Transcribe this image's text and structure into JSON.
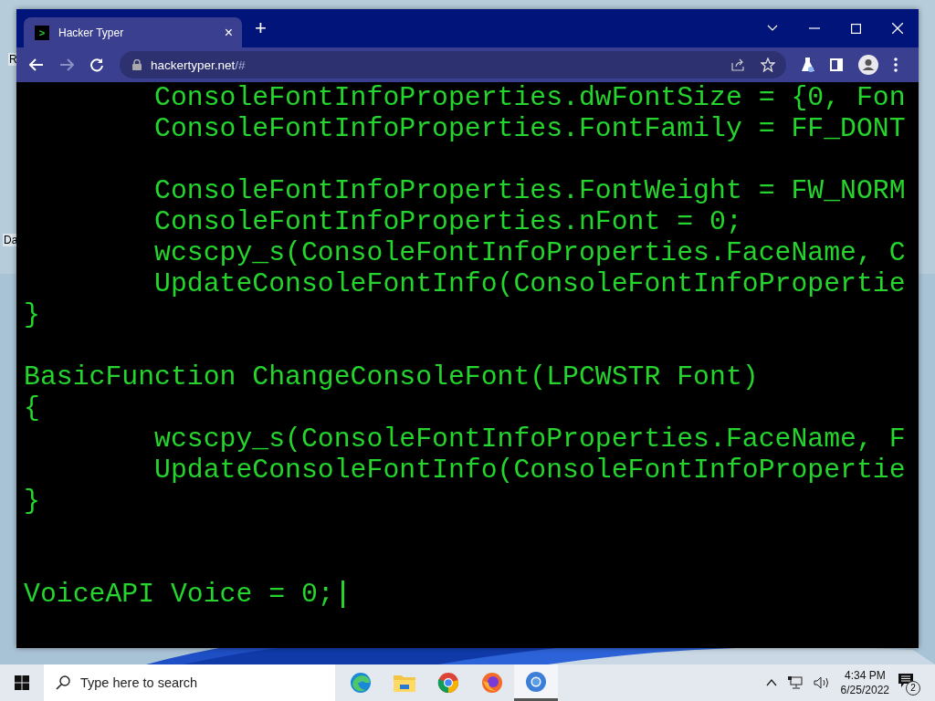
{
  "desktop": {
    "icon_labels": [
      "R",
      "Da"
    ]
  },
  "window": {
    "tabs": [
      {
        "title": "Hacker Typer",
        "selected": true,
        "favicon": ">",
        "close": "×"
      }
    ],
    "new_tab": "+",
    "address": {
      "host": "hackertyper.net",
      "path": "/#"
    }
  },
  "code": {
    "cursor_visible": true,
    "lines": [
      {
        "kind": "code",
        "text": "        ConsoleFontInfoProperties.dwFontSize = {0, Fon"
      },
      {
        "kind": "code",
        "text": "        ConsoleFontInfoProperties.FontFamily = FF_DONT"
      },
      {
        "kind": "blank"
      },
      {
        "kind": "code",
        "text": "        ConsoleFontInfoProperties.FontWeight = FW_NORM"
      },
      {
        "kind": "code",
        "text": "        ConsoleFontInfoProperties.nFont = 0;"
      },
      {
        "kind": "code",
        "text": "        wcscpy_s(ConsoleFontInfoProperties.FaceName, C"
      },
      {
        "kind": "code",
        "text": "        UpdateConsoleFontInfo(ConsoleFontInfoPropertie"
      },
      {
        "kind": "code",
        "text": "}"
      },
      {
        "kind": "blank"
      },
      {
        "kind": "code",
        "text": "BasicFunction ChangeConsoleFont(LPCWSTR Font)"
      },
      {
        "kind": "code",
        "text": "{"
      },
      {
        "kind": "code",
        "text": "        wcscpy_s(ConsoleFontInfoProperties.FaceName, F"
      },
      {
        "kind": "code",
        "text": "        UpdateConsoleFontInfo(ConsoleFontInfoPropertie"
      },
      {
        "kind": "code",
        "text": "}"
      },
      {
        "kind": "blank"
      },
      {
        "kind": "blank"
      },
      {
        "kind": "code",
        "text": "VoiceAPI Voice = 0;"
      }
    ]
  },
  "taskbar": {
    "search": {
      "placeholder": "Type here to search"
    },
    "apps": [
      {
        "kind": "edge",
        "active": false
      },
      {
        "kind": "folder",
        "active": false
      },
      {
        "kind": "chrome",
        "active": false
      },
      {
        "kind": "firefox",
        "active": false
      },
      {
        "kind": "chromium",
        "active": true
      }
    ],
    "clock": {
      "time": "4:34 PM",
      "date": "6/25/2022"
    },
    "notifications": "2"
  }
}
